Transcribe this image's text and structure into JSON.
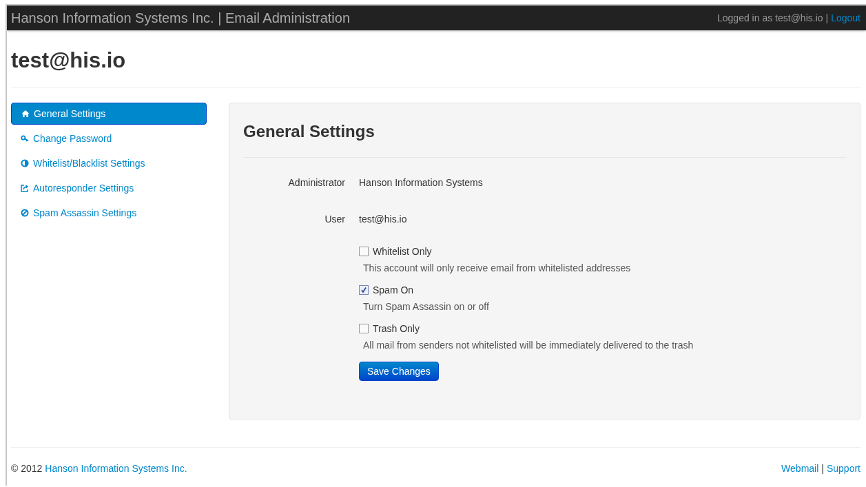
{
  "navbar": {
    "brand": "Hanson Information Systems Inc. | Email Administration",
    "logged_in": "Logged in as test@his.io",
    "separator": "|",
    "logout": "Logout"
  },
  "page_title": "test@his.io",
  "sidebar": {
    "items": [
      {
        "label": "General Settings",
        "selected": true
      },
      {
        "label": "Change Password",
        "selected": false
      },
      {
        "label": "Whitelist/Blacklist Settings",
        "selected": false
      },
      {
        "label": "Autoresponder Settings",
        "selected": false
      },
      {
        "label": "Spam Assassin Settings",
        "selected": false
      }
    ]
  },
  "panel": {
    "title": "General Settings",
    "fields": [
      {
        "label": "Administrator",
        "value": "Hanson Information Systems"
      },
      {
        "label": "User",
        "value": "test@his.io"
      }
    ],
    "options": [
      {
        "label": "Whitelist Only",
        "checked": false,
        "help": "This account will only receive email from whitelisted addresses"
      },
      {
        "label": "Spam On",
        "checked": true,
        "help": "Turn Spam Assassin on or off"
      },
      {
        "label": "Trash Only",
        "checked": false,
        "help": "All mail from senders not whitelisted will be immediately delivered to the trash"
      }
    ],
    "save_button": "Save Changes"
  },
  "footer": {
    "copyright": "© 2012",
    "company_link": "Hanson Information Systems Inc.",
    "links": [
      "Webmail",
      "Support"
    ],
    "separator": "|"
  }
}
